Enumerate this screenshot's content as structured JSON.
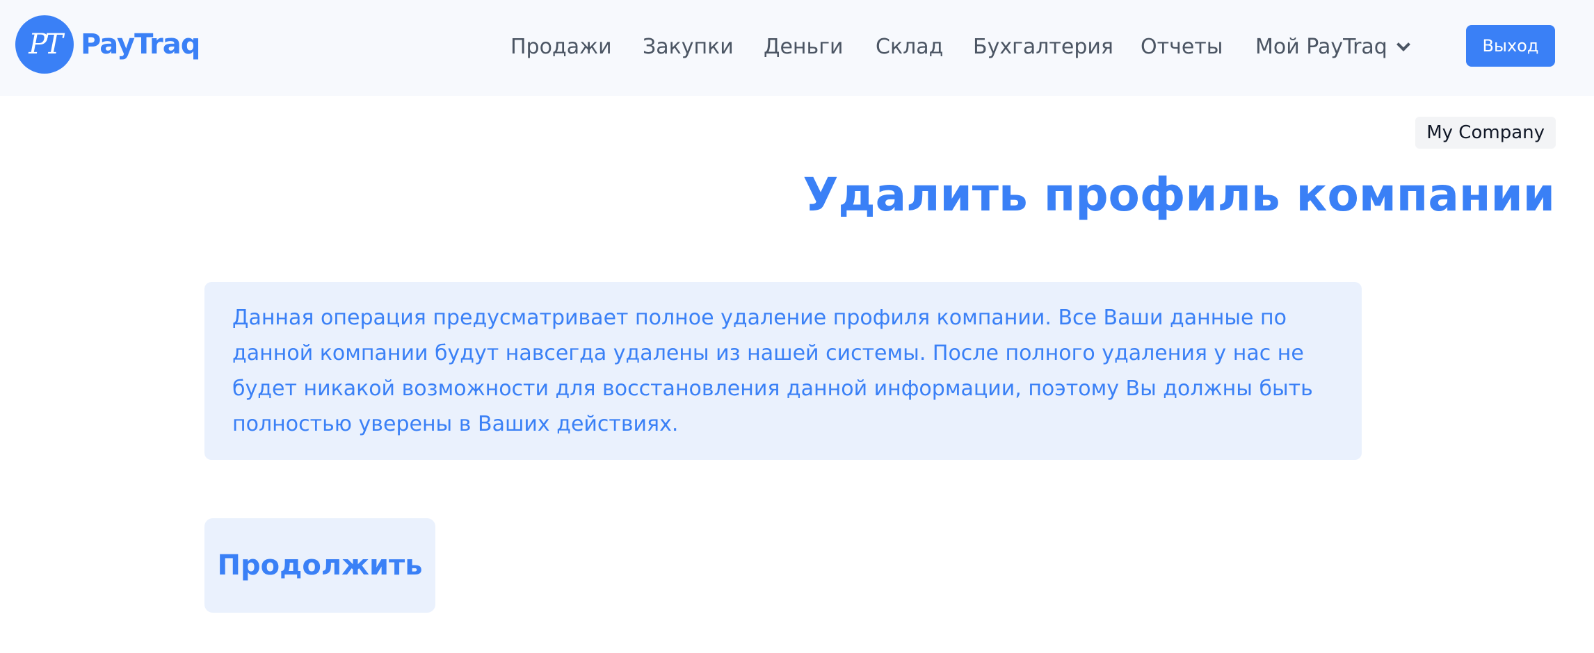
{
  "header": {
    "logo_mark": "PT",
    "logo_text": "PayTraq",
    "nav": [
      "Продажи",
      "Закупки",
      "Деньги",
      "Склад",
      "Бухгалтерия",
      "Отчеты",
      "Мой PayTraq"
    ],
    "logout_label": "Выход"
  },
  "company": {
    "name": "My Company"
  },
  "main": {
    "title": "Удалить профиль компании",
    "warning": "Данная операция предусматривает полное удаление профиля компании. Все Ваши данные по данной компании будут навсегда удалены из нашей системы. После полного удаления у нас не будет никакой возможности для восстановления данной информации, поэтому Вы должны быть полностью уверены в Ваших действиях.",
    "continue_label": "Продолжить"
  },
  "colors": {
    "accent": "#3a80f6",
    "header_bg": "#f7f9fd",
    "info_bg": "#eaf1fd",
    "nav_text": "#4b5563"
  }
}
